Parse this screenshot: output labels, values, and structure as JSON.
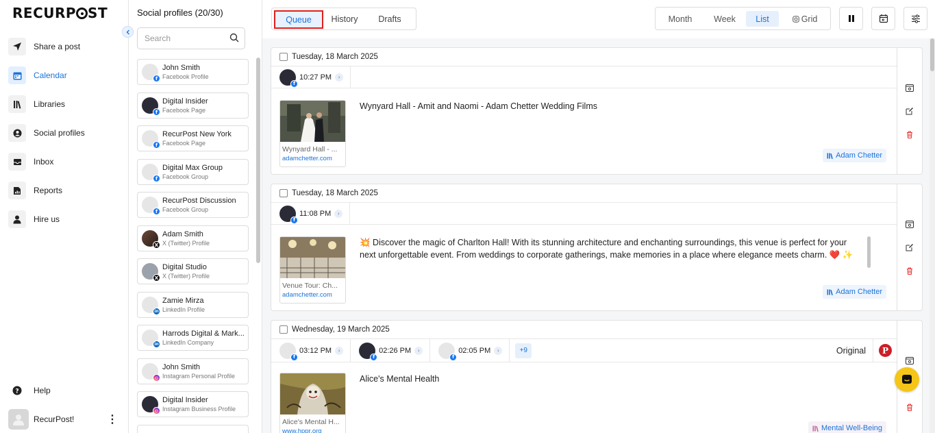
{
  "nav": {
    "logo": "RECURPOST",
    "items": [
      {
        "label": "Share a post",
        "icon": "send-icon"
      },
      {
        "label": "Calendar",
        "icon": "calendar-icon"
      },
      {
        "label": "Libraries",
        "icon": "library-icon"
      },
      {
        "label": "Social profiles",
        "icon": "user-circle-icon"
      },
      {
        "label": "Inbox",
        "icon": "inbox-icon"
      },
      {
        "label": "Reports",
        "icon": "report-icon"
      },
      {
        "label": "Hire us",
        "icon": "person-icon"
      }
    ],
    "active": "Calendar",
    "help": "Help",
    "user": "RecurPost!"
  },
  "profiles": {
    "title": "Social profiles (20/30)",
    "search_placeholder": "Search",
    "items": [
      {
        "name": "John Smith",
        "type": "Facebook Profile",
        "network": "fb"
      },
      {
        "name": "Digital Insider",
        "type": "Facebook Page",
        "network": "fb"
      },
      {
        "name": "RecurPost New York",
        "type": "Facebook Page",
        "network": "fb"
      },
      {
        "name": "Digital Max Group",
        "type": "Facebook Group",
        "network": "fb"
      },
      {
        "name": "RecurPost Discussion",
        "type": "Facebook Group",
        "network": "fb"
      },
      {
        "name": "Adam Smith",
        "type": "X (Twitter) Profile",
        "network": "x"
      },
      {
        "name": "Digital Studio",
        "type": "X (Twitter) Profile",
        "network": "x"
      },
      {
        "name": "Zamie Mirza",
        "type": "LinkedIn Profile",
        "network": "li"
      },
      {
        "name": "Harrods Digital & Mark...",
        "type": "LinkedIn Company",
        "network": "li"
      },
      {
        "name": "John Smith",
        "type": "Instagram Personal Profile",
        "network": "ig"
      },
      {
        "name": "Digital Insider",
        "type": "Instagram Business Profile",
        "network": "ig"
      }
    ]
  },
  "topbar": {
    "tabs": [
      "Queue",
      "History",
      "Drafts"
    ],
    "active_tab": "Queue",
    "views": [
      "Month",
      "Week",
      "List",
      "Grid"
    ],
    "active_view": "List"
  },
  "posts": [
    {
      "date": "Tuesday, 18 March 2025",
      "times": [
        "10:27 PM"
      ],
      "thumb_title": "Wynyard Hall - ...",
      "thumb_link": "adamchetter.com",
      "text": "Wynyard Hall - Amit and Naomi - Adam Chetter Wedding Films",
      "library": "Adam Chetter"
    },
    {
      "date": "Tuesday, 18 March 2025",
      "times": [
        "11:08 PM"
      ],
      "thumb_title": "Venue Tour: Ch...",
      "thumb_link": "adamchetter.com",
      "text": "💥 Discover the magic of Charlton Hall! With its stunning architecture and enchanting surroundings, this venue is perfect for your next unforgettable event. From weddings to corporate gatherings, make memories in a place where elegance meets charm. ❤️ ✨",
      "library": "Adam Chetter"
    },
    {
      "date": "Wednesday, 19 March 2025",
      "times": [
        "03:12 PM",
        "02:26 PM",
        "02:05 PM"
      ],
      "more": "+9",
      "original": "Original",
      "thumb_title": "Alice's Mental H...",
      "thumb_link": "www.hppr.org",
      "text": "Alice's Mental Health",
      "library": "Mental Well-Being"
    }
  ]
}
